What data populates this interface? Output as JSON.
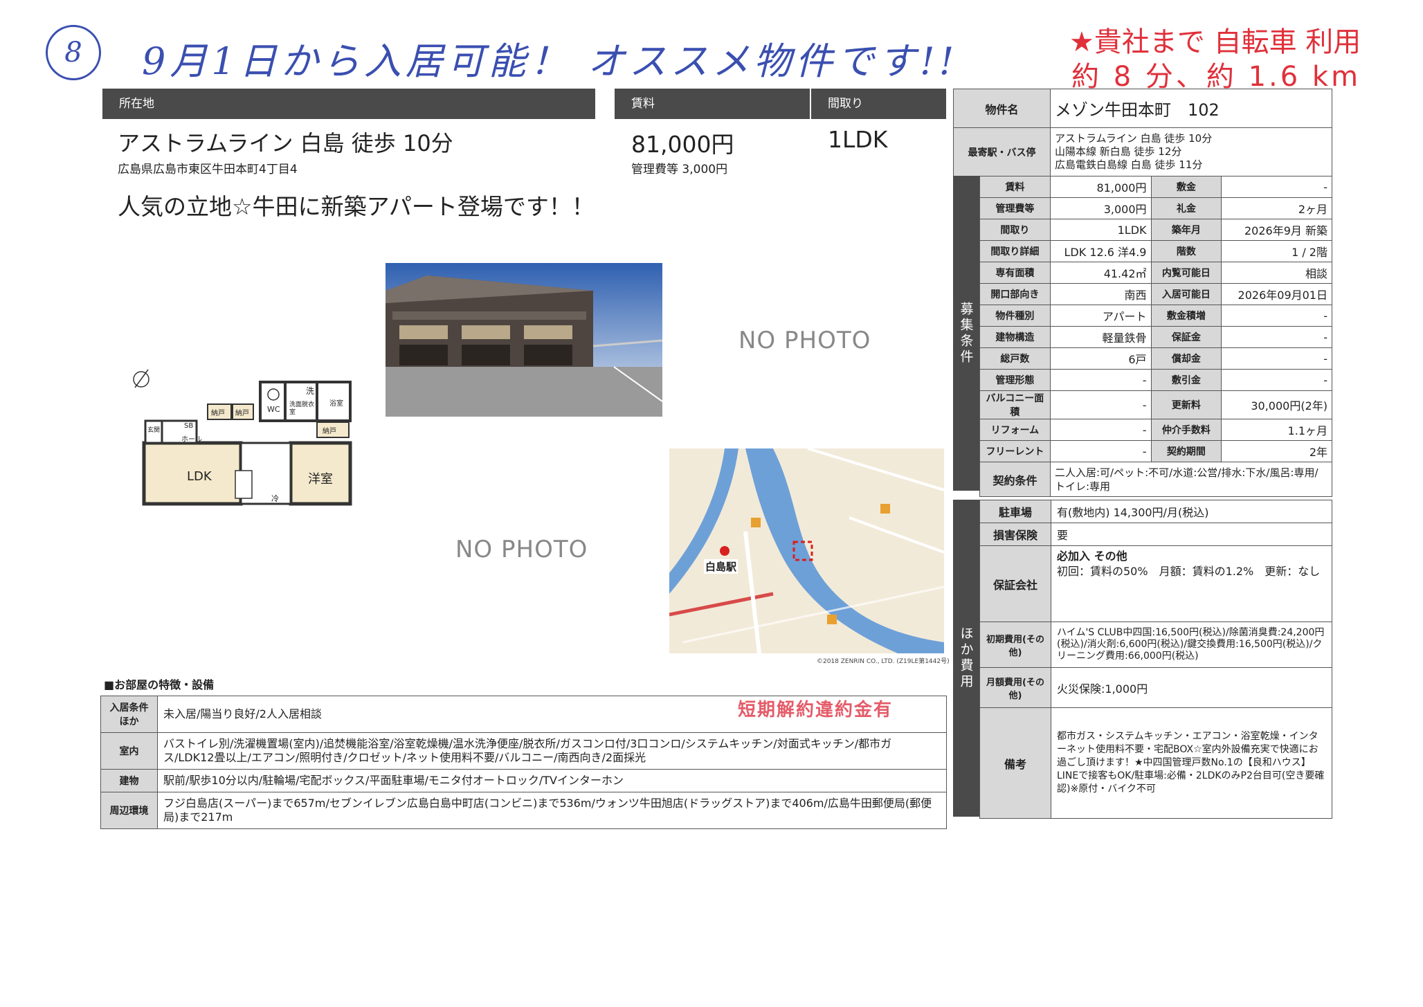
{
  "handwritten": {
    "circle_number": "8",
    "note": "9月1日から入居可能！ オススメ物件です!!",
    "access_line1": "★貴社まで 自転車 利用",
    "access_line2": "約 8 分、約 1.6 km"
  },
  "header": {
    "location_label": "所在地",
    "rent_label": "賃料",
    "layout_label": "間取り",
    "station": "アストラムライン 白島 徒歩 10分",
    "address": "広島県広島市東区牛田本町4丁目4",
    "rent": "81,000円",
    "management_fee": "管理費等 3,000円",
    "layout": "1LDK",
    "catchphrase": "人気の立地☆牛田に新築アパート登場です！！"
  },
  "photos": {
    "no_photo_1": "NO PHOTO",
    "no_photo_2": "NO PHOTO",
    "map_credit": "©2018 ZENRIN CO., LTD. (Z19LE第1442号)",
    "map_station": "白島駅"
  },
  "floorplan": {
    "ldk": "LDK",
    "youshitsu": "洋室",
    "hall": "ホール",
    "sb": "SB",
    "wc": "WC",
    "nando1": "納戸",
    "nando2": "納戸",
    "nando3": "納戸",
    "washroom": "洗面脱衣室",
    "bath": "浴室",
    "laundry": "洗",
    "fridge": "冷",
    "entrance": "玄関"
  },
  "property": {
    "name_label": "物件名",
    "name": "メゾン牛田本町　102",
    "station_label": "最寄駅・バス停",
    "stations": [
      "アストラムライン 白島 徒歩 10分",
      "山陽本線 新白島 徒歩 12分",
      "広島電鉄白島線 白島 徒歩 11分"
    ],
    "section_label": "募集条件",
    "rows": [
      {
        "l1": "賃料",
        "v1": "81,000円",
        "l2": "敷金",
        "v2": "-"
      },
      {
        "l1": "管理費等",
        "v1": "3,000円",
        "l2": "礼金",
        "v2": "2ヶ月"
      },
      {
        "l1": "間取り",
        "v1": "1LDK",
        "l2": "築年月",
        "v2": "2026年9月 新築"
      },
      {
        "l1": "間取り詳細",
        "v1": "LDK 12.6 洋4.9",
        "l2": "階数",
        "v2": "1 / 2階"
      },
      {
        "l1": "専有面積",
        "v1": "41.42㎡",
        "l2": "内覧可能日",
        "v2": "相談"
      },
      {
        "l1": "開口部向き",
        "v1": "南西",
        "l2": "入居可能日",
        "v2": "2026年09月01日"
      },
      {
        "l1": "物件種別",
        "v1": "アパート",
        "l2": "敷金積増",
        "v2": "-"
      },
      {
        "l1": "建物構造",
        "v1": "軽量鉄骨",
        "l2": "保証金",
        "v2": "-"
      },
      {
        "l1": "総戸数",
        "v1": "6戸",
        "l2": "償却金",
        "v2": "-"
      },
      {
        "l1": "管理形態",
        "v1": "-",
        "l2": "敷引金",
        "v2": "-"
      },
      {
        "l1": "バルコニー面積",
        "v1": "-",
        "l2": "更新料",
        "v2": "30,000円(2年)"
      },
      {
        "l1": "リフォーム",
        "v1": "-",
        "l2": "仲介手数料",
        "v2": "1.1ヶ月"
      },
      {
        "l1": "フリーレント",
        "v1": "-",
        "l2": "契約期間",
        "v2": "2年"
      }
    ],
    "contract_label": "契約条件",
    "contract": "二人入居:可/ペット:不可/水道:公営/排水:下水/風呂:専用/トイレ:専用"
  },
  "other_costs": {
    "section_label": "ほか費用",
    "parking_label": "駐車場",
    "parking": "有(敷地内) 14,300円/月(税込)",
    "insurance_label": "損害保険",
    "insurance": "要",
    "guarantor_label": "保証会社",
    "guarantor_1": "必加入 その他",
    "guarantor_2": "初回：賃料の50%　月額：賃料の1.2%　更新：なし",
    "initial_label": "初期費用(その他)",
    "initial": "ハイム'S CLUB中四国:16,500円(税込)/除菌消臭費:24,200円(税込)/消火剤:6,600円(税込)/鍵交換費用:16,500円(税込)/クリーニング費用:66,000円(税込)",
    "monthly_label": "月額費用(その他)",
    "monthly": "火災保険:1,000円",
    "remarks_label": "備考",
    "remarks": "都市ガス・システムキッチン・エアコン・浴室乾燥・インターネット使用料不要・宅配BOX☆室内外設備充実で快適にお過ごし頂けます！★中四国管理戸数No.1の【良和ハウス】LINEで接客もOK/駐車場:必備・2LDKのみP2台目可(空き要確認)※原付・バイク不可"
  },
  "features": {
    "title": "■お部屋の特徴・設備",
    "stamp": "短期解約違約金有",
    "rows": [
      {
        "label": "入居条件ほか",
        "value": "未入居/陽当り良好/2人入居相談"
      },
      {
        "label": "室内",
        "value": "バストイレ別/洗濯機置場(室内)/追焚機能浴室/浴室乾燥機/温水洗浄便座/脱衣所/ガスコンロ付/3口コンロ/システムキッチン/対面式キッチン/都市ガス/LDK12畳以上/エアコン/照明付き/クロゼット/ネット使用料不要/バルコニー/南西向き/2面採光"
      },
      {
        "label": "建物",
        "value": "駅前/駅歩10分以内/駐輪場/宅配ボックス/平面駐車場/モニタ付オートロック/TVインターホン"
      },
      {
        "label": "周辺環境",
        "value": "フジ白島店(スーパー)まで657m/セブンイレブン広島白島中町店(コンビニ)まで536m/ウォンツ牛田旭店(ドラッグストア)まで406m/広島牛田郵便局(郵便局)まで217m"
      }
    ]
  }
}
